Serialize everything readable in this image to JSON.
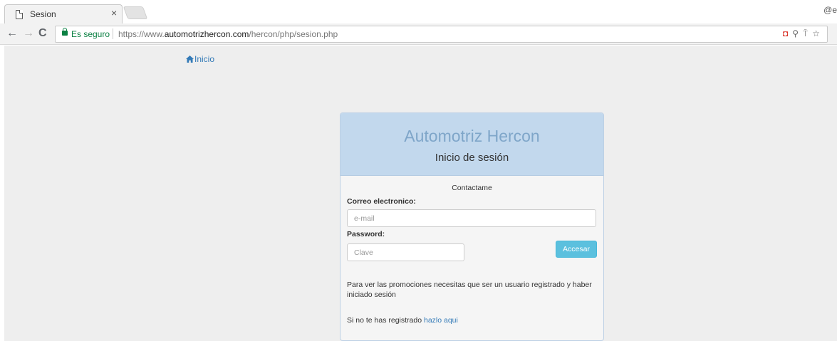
{
  "browser": {
    "tab_title": "Sesion",
    "tab_close": "×",
    "profile_label": "@e",
    "secure_label": "Es seguro",
    "url_scheme": "https://www.",
    "url_host": "automotrizhercon.com",
    "url_path": "/hercon/php/sesion.php",
    "back_glyph": "←",
    "forward_glyph": "→",
    "reload_glyph": "C"
  },
  "nav": {
    "home_label": "Inicio"
  },
  "login": {
    "brand": "Automotriz Hercon",
    "heading": "Inicio de sesión",
    "contact": "Contactame",
    "email_label": "Correo electronico:",
    "email_placeholder": "e-mail",
    "email_value": "",
    "password_label": "Password:",
    "password_placeholder": "Clave",
    "password_value": "",
    "submit_label": "Accesar",
    "info_text": "Para ver las promociones necesitas que ser un usuario registrado y haber iniciado sesión",
    "register_prefix": "Si no te has registrado ",
    "register_link": "hazlo aqui"
  },
  "colors": {
    "page_bg": "#eeeeee",
    "panel_header_bg": "#c2d8ed",
    "brand_text": "#7fa6c9",
    "link": "#337ab7",
    "button_info": "#5bc0de",
    "secure_green": "#0b8043"
  },
  "icons": {
    "tab_favicon": "page-icon",
    "home": "home-icon",
    "lock": "lock-icon",
    "extensions": [
      "extension-icon",
      "zoom-icon",
      "pin-icon",
      "star-icon"
    ]
  }
}
